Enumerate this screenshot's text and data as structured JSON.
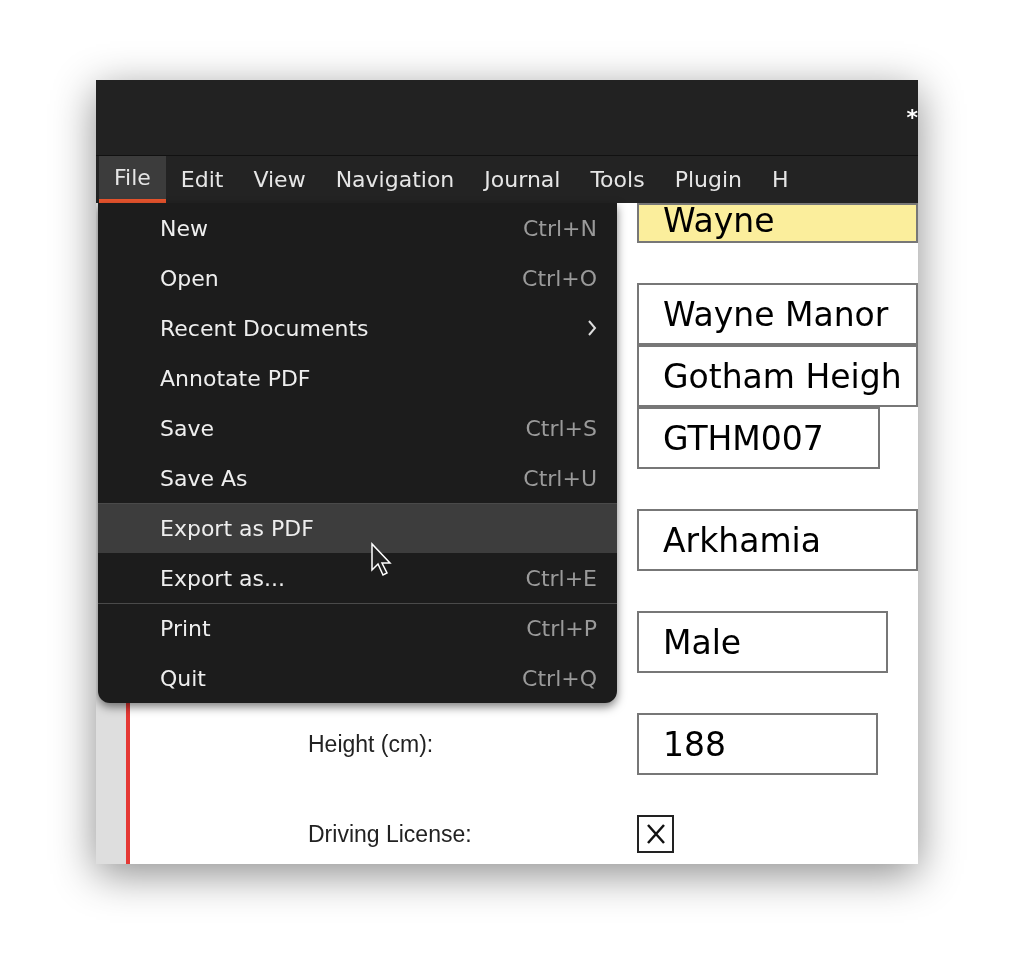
{
  "window": {
    "title": "*"
  },
  "menu_bar": [
    {
      "label": "File",
      "selected": true
    },
    {
      "label": "Edit",
      "selected": false
    },
    {
      "label": "View",
      "selected": false
    },
    {
      "label": "Navigation",
      "selected": false
    },
    {
      "label": "Journal",
      "selected": false
    },
    {
      "label": "Tools",
      "selected": false
    },
    {
      "label": "Plugin",
      "selected": false
    },
    {
      "label": "H",
      "selected": false
    }
  ],
  "file_menu": [
    {
      "label": "New",
      "shortcut": "Ctrl+N",
      "selected": false,
      "separator_before": false
    },
    {
      "label": "Open",
      "shortcut": "Ctrl+O",
      "selected": false,
      "separator_before": false
    },
    {
      "label": "Recent Documents",
      "submenu": true,
      "selected": false,
      "separator_before": false
    },
    {
      "label": "Annotate PDF",
      "selected": false,
      "separator_before": false
    },
    {
      "label": "Save",
      "shortcut": "Ctrl+S",
      "selected": false,
      "separator_before": false
    },
    {
      "label": "Save As",
      "shortcut": "Ctrl+U",
      "selected": false,
      "separator_before": false
    },
    {
      "label": "Export as PDF",
      "selected": true,
      "separator_before": true
    },
    {
      "label": "Export as...",
      "shortcut": "Ctrl+E",
      "selected": false,
      "separator_before": false
    },
    {
      "label": "Print",
      "shortcut": "Ctrl+P",
      "selected": false,
      "separator_before": true
    },
    {
      "label": "Quit",
      "shortcut": "Ctrl+Q",
      "selected": false,
      "separator_before": false
    }
  ],
  "form_groups": [
    [
      {
        "kind": "text",
        "value": "Wayne",
        "highlighted": true
      }
    ],
    [
      {
        "kind": "text",
        "value": "Wayne Manor",
        "highlighted": false
      },
      {
        "kind": "text",
        "value": "Gotham Heigh",
        "highlighted": false
      },
      {
        "kind": "text",
        "value": "GTHM007",
        "highlighted": false
      }
    ],
    [
      {
        "kind": "text",
        "value": "Arkhamia",
        "highlighted": false
      }
    ],
    [
      {
        "kind": "text",
        "value": "Male",
        "highlighted": false
      }
    ],
    [
      {
        "kind": "text",
        "label": "Height (cm):",
        "value": "188",
        "highlighted": false
      }
    ],
    [
      {
        "kind": "checkbox",
        "label": "Driving License:",
        "checked": true
      }
    ]
  ]
}
